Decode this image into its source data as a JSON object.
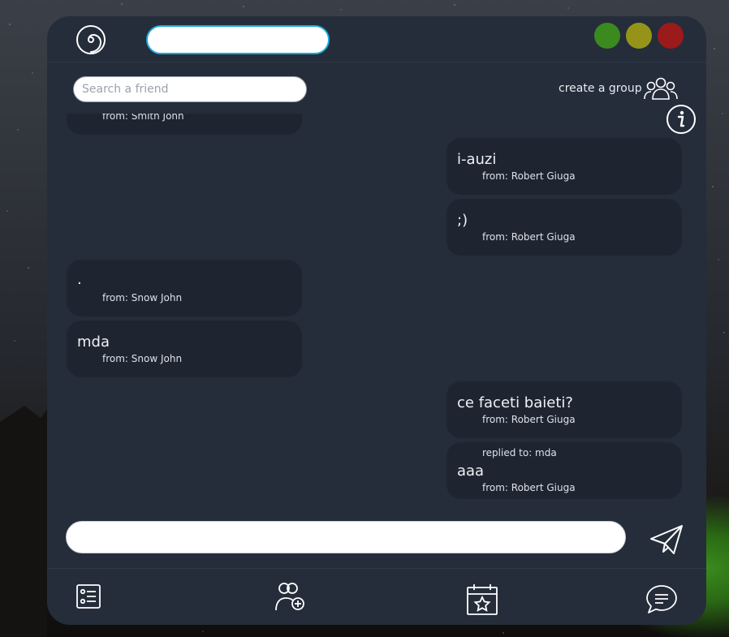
{
  "top_input": {
    "value": ""
  },
  "search": {
    "placeholder": "Search a friend"
  },
  "create_group_label": "create a group",
  "messages": [
    {
      "side": "left",
      "text": "",
      "from": "from: Smith John"
    },
    {
      "side": "right",
      "text": "i-auzi",
      "from": "from: Robert Giuga"
    },
    {
      "side": "right",
      "text": ";)",
      "from": "from: Robert Giuga"
    },
    {
      "side": "left",
      "text": ".",
      "from": "from: Snow John"
    },
    {
      "side": "left",
      "text": "mda",
      "from": "from: Snow John"
    },
    {
      "side": "right",
      "text": "ce faceti baieti?",
      "from": "from: Robert Giuga"
    },
    {
      "side": "right",
      "reply": "replied to: mda",
      "text": "aaa",
      "from": "from: Robert Giuga"
    }
  ],
  "composer": {
    "value": ""
  },
  "icons": {
    "logo": "swirl-logo-icon",
    "group": "group-icon",
    "info": "info-icon",
    "send": "send-icon",
    "bottom": [
      "tasks-icon",
      "add-friend-icon",
      "calendar-icon",
      "chat-icon"
    ]
  },
  "colors": {
    "panel": "#252d3b",
    "bubble": "#1e2531",
    "window_green": "#3a8a1f",
    "window_yellow": "#959418",
    "window_red": "#9b1a1a",
    "input_focus": "#1ea8d8"
  }
}
